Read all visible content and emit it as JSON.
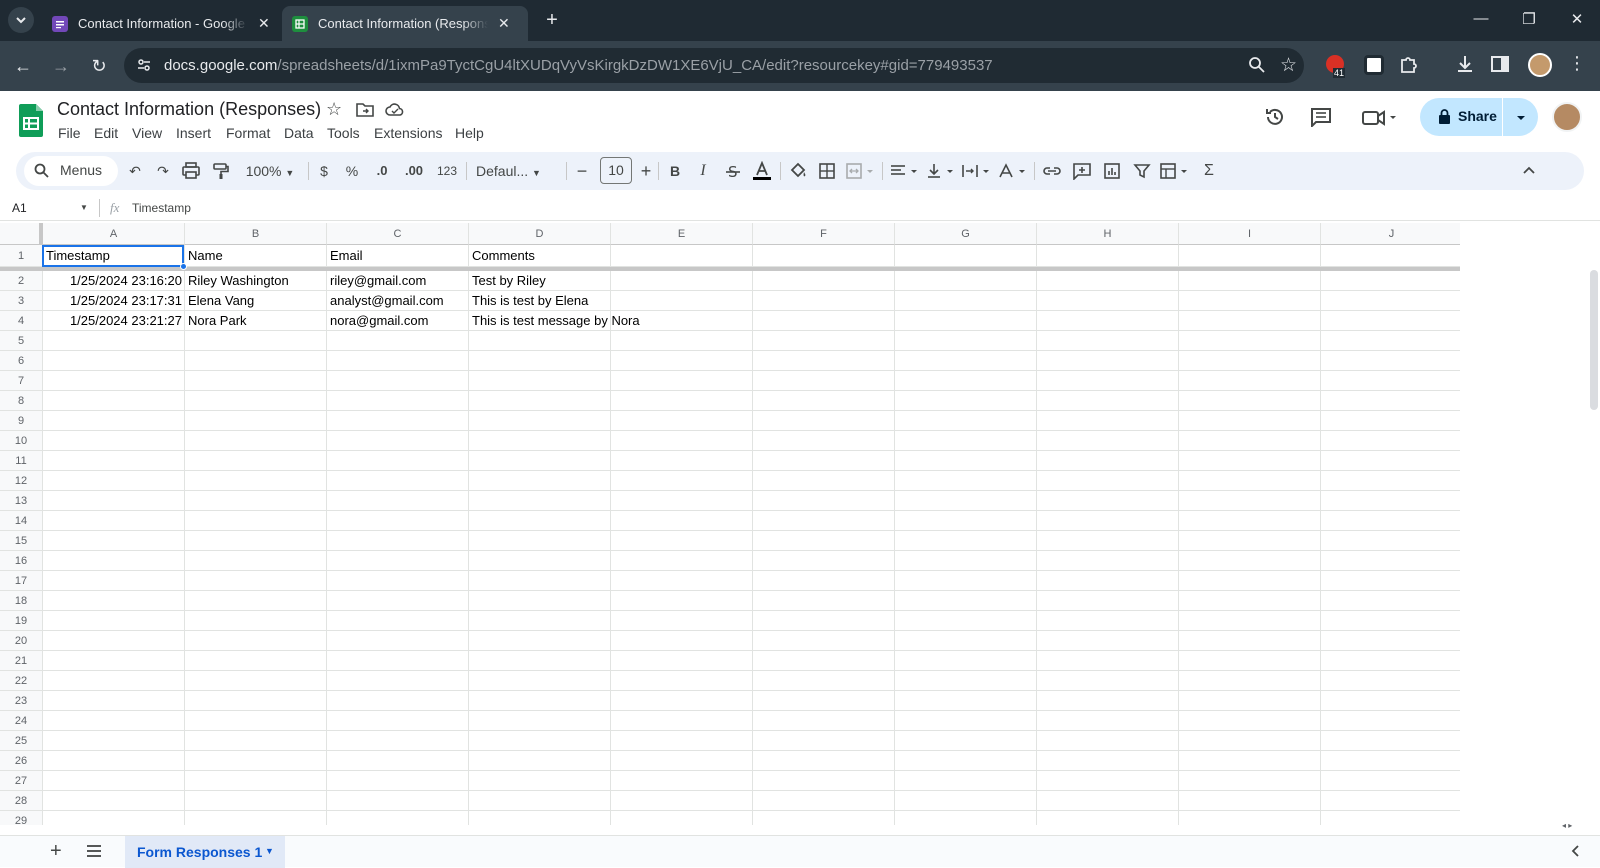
{
  "browser": {
    "tabs": [
      {
        "title": "Contact Information - Google F",
        "icon": "google-forms-icon"
      },
      {
        "title": "Contact Information (Responses",
        "icon": "google-sheets-icon"
      }
    ],
    "url_domain": "docs.google.com",
    "url_path": "/spreadsheets/d/1ixmPa9TyctCgU4ltXUDqVyVsKirgkDzDW1XE6VjU_CA/edit?resourcekey#gid=779493537",
    "extension_badge": "41"
  },
  "app": {
    "title": "Contact Information (Responses)",
    "menus": [
      "File",
      "Edit",
      "View",
      "Insert",
      "Format",
      "Data",
      "Tools",
      "Extensions",
      "Help"
    ],
    "share_label": "Share"
  },
  "toolbar": {
    "search_label": "Menus",
    "zoom": "100%",
    "currency": "$",
    "percent": "%",
    "dec_decrease": ".0",
    "dec_increase": ".00",
    "number_format": "123",
    "font": "Defaul...",
    "font_size": "10",
    "bold": "B",
    "italic": "I"
  },
  "formula_bar": {
    "cell_ref": "A1",
    "fx": "fx",
    "content": "Timestamp"
  },
  "sheet": {
    "columns": [
      "A",
      "B",
      "C",
      "D",
      "E",
      "F",
      "G",
      "H",
      "I",
      "J"
    ],
    "rows": [
      "1",
      "2",
      "3",
      "4",
      "5",
      "6",
      "7",
      "8",
      "9",
      "10",
      "11",
      "12",
      "13",
      "14",
      "15",
      "16",
      "17",
      "18",
      "19",
      "20",
      "21",
      "22",
      "23",
      "24",
      "25",
      "26",
      "27",
      "28",
      "29"
    ],
    "header": [
      "Timestamp",
      "Name",
      "Email",
      "Comments"
    ],
    "data": [
      [
        "1/25/2024 23:16:20",
        "Riley Washington",
        "riley@gmail.com",
        "Test by Riley"
      ],
      [
        "1/25/2024 23:17:31",
        "Elena Vang",
        "analyst@gmail.com",
        "This is test by Elena"
      ],
      [
        "1/25/2024 23:21:27",
        "Nora Park",
        "nora@gmail.com",
        "This is test message by Nora"
      ]
    ]
  },
  "bottom": {
    "sheet_tab": "Form Responses 1"
  }
}
